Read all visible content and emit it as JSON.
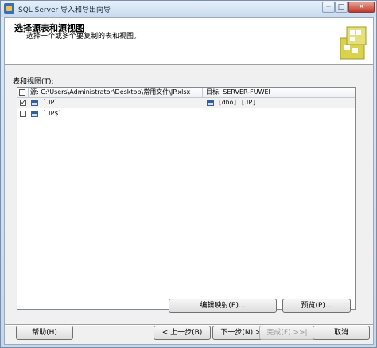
{
  "window": {
    "title": "SQL Server 导入和导出向导",
    "min_label": "─",
    "max_label": "□",
    "close_label": "✕"
  },
  "header": {
    "title": "选择源表和源视图",
    "subtitle": "选择一个或多个要复制的表和视图。"
  },
  "list": {
    "label": "表和视图(T):",
    "columns": {
      "source": "源: C:\\Users\\Administrator\\Desktop\\常用文件\\JP.xlsx",
      "destination": "目标: SERVER-FUWEI"
    },
    "rows": [
      {
        "checked": true,
        "check_mark": "✓",
        "source": "`JP`",
        "destination": "[dbo].[JP]"
      },
      {
        "checked": false,
        "check_mark": "",
        "source": "`JP$`",
        "destination": ""
      }
    ]
  },
  "buttons": {
    "edit_mappings": "编辑映射(E)...",
    "preview": "预览(P)...",
    "help": "帮助(H)",
    "back": "< 上一步(B)",
    "next": "下一步(N) >",
    "finish": "完成(F) >>|",
    "cancel": "取消"
  },
  "icons": {
    "app": "sql-server-wizard-icon",
    "header": "wizard-graphic-icon",
    "table": "table-icon"
  },
  "colors": {
    "selected_row": "#f2f2f2",
    "header_graphic": "#c9c243"
  }
}
